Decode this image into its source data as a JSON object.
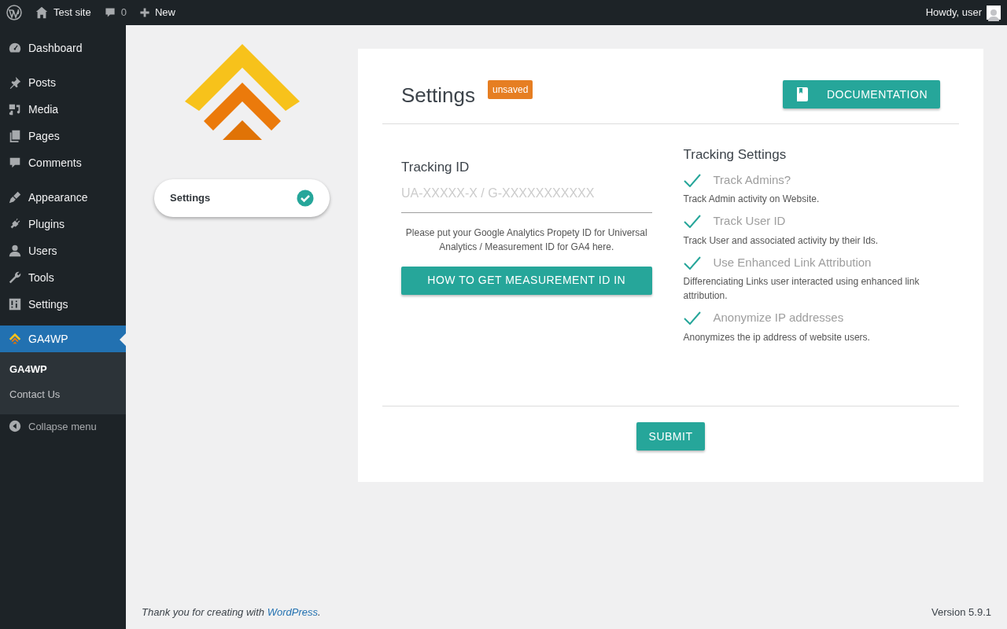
{
  "admin_bar": {
    "site_name": "Test site",
    "comments_count": "0",
    "new_label": "New",
    "greeting": "Howdy, user"
  },
  "sidebar": {
    "groups": [
      {
        "items": [
          {
            "label": "Dashboard",
            "selected": false
          }
        ]
      },
      {
        "items": [
          {
            "label": "Posts",
            "selected": false
          },
          {
            "label": "Media",
            "selected": false
          },
          {
            "label": "Pages",
            "selected": false
          },
          {
            "label": "Comments",
            "selected": false
          }
        ]
      },
      {
        "items": [
          {
            "label": "Appearance",
            "selected": false
          },
          {
            "label": "Plugins",
            "selected": false
          },
          {
            "label": "Users",
            "selected": false
          },
          {
            "label": "Tools",
            "selected": false
          },
          {
            "label": "Settings",
            "selected": false
          }
        ]
      },
      {
        "items": [
          {
            "label": "GA4WP",
            "selected": true,
            "children": [
              {
                "label": "GA4WP",
                "selected": true
              },
              {
                "label": "Contact Us",
                "selected": false
              }
            ]
          }
        ]
      }
    ],
    "collapse_label": "Collapse menu"
  },
  "steps": [
    {
      "label": "Settings",
      "done": true
    }
  ],
  "settings": {
    "title": "Settings",
    "status_badge": "unsaved",
    "documentation_button": "DOCUMENTATION",
    "tracking_id": {
      "label": "Tracking ID",
      "placeholder": "UA-XXXXX-X / G-XXXXXXXXXXX",
      "help": "Please put your Google Analytics Propety ID for Universal Analytics / Measurement ID for GA4 here.",
      "help_button": "HOW TO GET MEASUREMENT ID IN"
    },
    "tracking_settings": {
      "title": "Tracking Settings",
      "options": [
        {
          "label": "Track Admins?",
          "description": "Track Admin activity on Website.",
          "checked": true
        },
        {
          "label": "Track User ID",
          "description": "Track User and associated activity by their Ids.",
          "checked": true
        },
        {
          "label": "Use Enhanced Link Attribution",
          "description": "Differenciating Links user interacted using enhanced link attribution.",
          "checked": true
        },
        {
          "label": "Anonymize IP addresses",
          "description": "Anonymizes the ip address of website users.",
          "checked": true
        }
      ]
    },
    "submit_button": "SUBMIT"
  },
  "footer": {
    "thanks": "Thank you for creating with ",
    "link": "WordPress",
    "after_link": ".",
    "version": "Version 5.9.1"
  }
}
